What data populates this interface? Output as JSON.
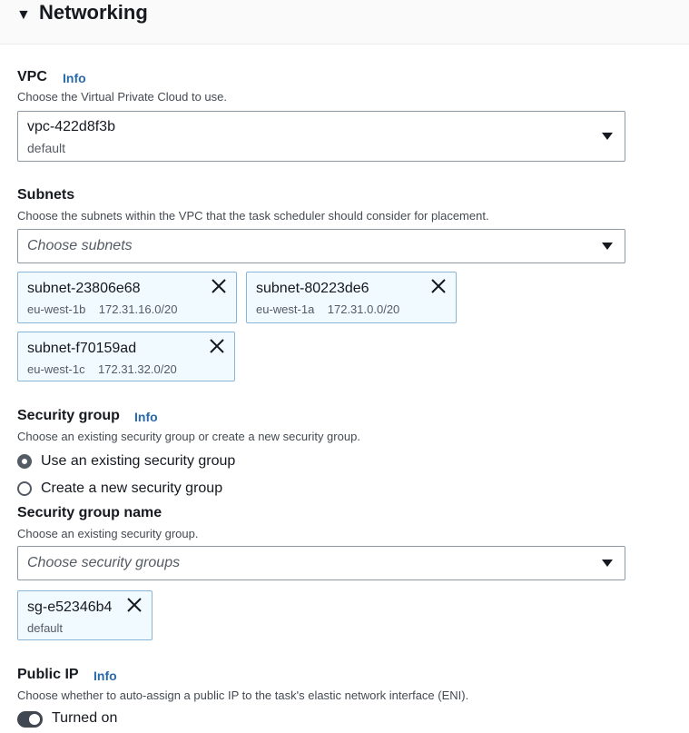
{
  "section": {
    "title": "Networking",
    "expand_icon": "caret-down-icon"
  },
  "vpc": {
    "label": "VPC",
    "info": "Info",
    "description": "Choose the Virtual Private Cloud to use.",
    "selected_value": "vpc-422d8f3b",
    "selected_detail": "default"
  },
  "subnets": {
    "label": "Subnets",
    "description": "Choose the subnets within the VPC that the task scheduler should consider for placement.",
    "placeholder": "Choose subnets",
    "tokens": [
      {
        "name": "subnet-23806e68",
        "detail": "eu-west-1b    172.31.16.0/20"
      },
      {
        "name": "subnet-80223de6",
        "detail": "eu-west-1a    172.31.0.0/20"
      },
      {
        "name": "subnet-f70159ad",
        "detail": "eu-west-1c    172.31.32.0/20"
      }
    ]
  },
  "security_group": {
    "label": "Security group",
    "info": "Info",
    "description": "Choose an existing security group or create a new security group.",
    "options": [
      {
        "label": "Use an existing security group",
        "selected": true
      },
      {
        "label": "Create a new security group",
        "selected": false
      }
    ],
    "name_label": "Security group name",
    "name_description": "Choose an existing security group.",
    "placeholder": "Choose security groups",
    "tokens": [
      {
        "name": "sg-e52346b4",
        "detail": "default"
      }
    ]
  },
  "public_ip": {
    "label": "Public IP",
    "info": "Info",
    "description": "Choose whether to auto-assign a public IP to the task's elastic network interface (ENI).",
    "toggle_label": "Turned on",
    "toggle_on": true
  },
  "colors": {
    "info_link": "#2a6aa9",
    "token_bg": "#f1faff",
    "token_border": "#8ab5d6",
    "toggle_on": "#414750"
  }
}
